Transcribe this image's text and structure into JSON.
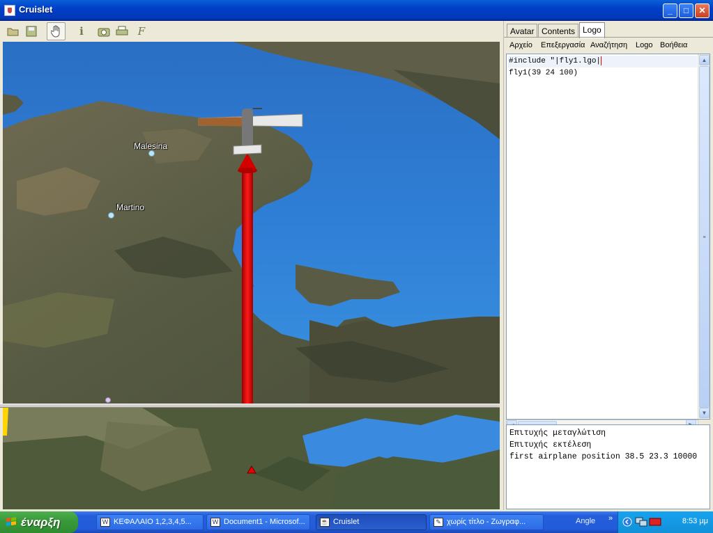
{
  "window": {
    "title": "Cruislet",
    "min": "_",
    "max": "□",
    "close": "✕"
  },
  "toolbar": {
    "icons": [
      "open-folder-icon",
      "save-icon",
      "hand-icon",
      "info-icon",
      "camera-icon",
      "print-icon",
      "function-icon"
    ]
  },
  "map": {
    "places": [
      {
        "name": "Malesina"
      },
      {
        "name": "Martino"
      }
    ]
  },
  "panel": {
    "tabs": [
      "Avatar",
      "Contents",
      "Logo"
    ],
    "active_tab": "Logo",
    "menu": [
      "Αρχείο",
      "Επεξεργασία",
      "Αναζήτηση",
      "Logo",
      "Βοήθεια"
    ],
    "code_lines": [
      "#include \"|fly1.lgo|",
      "fly1(39 24 100)"
    ],
    "output_lines": [
      "Επιτυχής μεταγλώτιση",
      "Επιτυχής εκτέλεση",
      "first airplane position 38.5 23.3 10000"
    ]
  },
  "taskbar": {
    "start_label": "έναρξη",
    "tasks": [
      "ΚΕΦΑΛΑΙΟ 1,2,3,4,5...",
      "Document1 - Microsof...",
      "Cruislet",
      "χωρίς τίτλο - Ζωγραφ..."
    ],
    "lang": "Angle",
    "chevron": "»",
    "clock": "8:53 μμ"
  }
}
